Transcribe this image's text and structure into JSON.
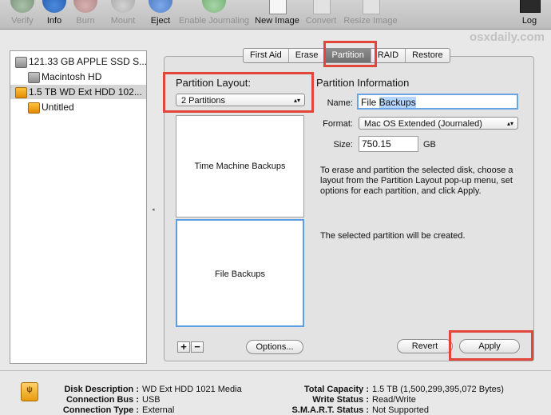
{
  "toolbar": {
    "items": [
      {
        "label": "Verify",
        "icon": "verify-icon",
        "enabled": false
      },
      {
        "label": "Info",
        "icon": "info-icon",
        "enabled": true
      },
      {
        "label": "Burn",
        "icon": "burn-icon",
        "enabled": false
      },
      {
        "label": "Mount",
        "icon": "mount-icon",
        "enabled": false
      },
      {
        "label": "Eject",
        "icon": "eject-icon",
        "enabled": true
      },
      {
        "label": "Enable Journaling",
        "icon": "journaling-icon",
        "enabled": false
      },
      {
        "label": "New Image",
        "icon": "new-image-icon",
        "enabled": true
      },
      {
        "label": "Convert",
        "icon": "convert-icon",
        "enabled": false
      },
      {
        "label": "Resize Image",
        "icon": "resize-image-icon",
        "enabled": false
      },
      {
        "label": "Log",
        "icon": "log-icon",
        "enabled": true
      }
    ]
  },
  "watermark": "osxdaily.com",
  "sidebar": {
    "items": [
      {
        "label": "121.33 GB APPLE SSD S...",
        "type": "disk",
        "selected": false
      },
      {
        "label": "Macintosh HD",
        "type": "volume",
        "selected": false
      },
      {
        "label": "1.5 TB WD Ext HDD 102...",
        "type": "disk",
        "selected": true
      },
      {
        "label": "Untitled",
        "type": "volume",
        "selected": false
      }
    ]
  },
  "tabs": [
    {
      "label": "First Aid",
      "active": false
    },
    {
      "label": "Erase",
      "active": false
    },
    {
      "label": "Partition",
      "active": true
    },
    {
      "label": "RAID",
      "active": false
    },
    {
      "label": "Restore",
      "active": false
    }
  ],
  "partition": {
    "layout_heading": "Partition Layout:",
    "layout_value": "2 Partitions",
    "partitions": [
      {
        "name": "Time Machine Backups",
        "selected": false
      },
      {
        "name": "File Backups",
        "selected": true
      }
    ],
    "add_label": "+",
    "remove_label": "−",
    "options_label": "Options...",
    "info_heading": "Partition Information",
    "name_label": "Name:",
    "name_value_plain": "File ",
    "name_value_selected": "Backups",
    "format_label": "Format:",
    "format_value": "Mac OS Extended (Journaled)",
    "size_label": "Size:",
    "size_value": "750.15",
    "size_unit": "GB",
    "instructions": "To erase and partition the selected disk, choose a layout from the Partition Layout pop-up menu, set options for each partition, and click Apply.",
    "status": "The selected partition will be created.",
    "revert_label": "Revert",
    "apply_label": "Apply"
  },
  "disk_info": {
    "left": [
      {
        "key": "Disk Description :",
        "value": "WD Ext HDD 1021 Media"
      },
      {
        "key": "Connection Bus :",
        "value": "USB"
      },
      {
        "key": "Connection Type :",
        "value": "External"
      }
    ],
    "right": [
      {
        "key": "Total Capacity :",
        "value": "1.5 TB (1,500,299,395,072 Bytes)"
      },
      {
        "key": "Write Status :",
        "value": "Read/Write"
      },
      {
        "key": "S.M.A.R.T. Status :",
        "value": "Not Supported"
      }
    ]
  },
  "colors": {
    "highlight": "#e2463a",
    "selection_blue": "#5c9ee4"
  }
}
